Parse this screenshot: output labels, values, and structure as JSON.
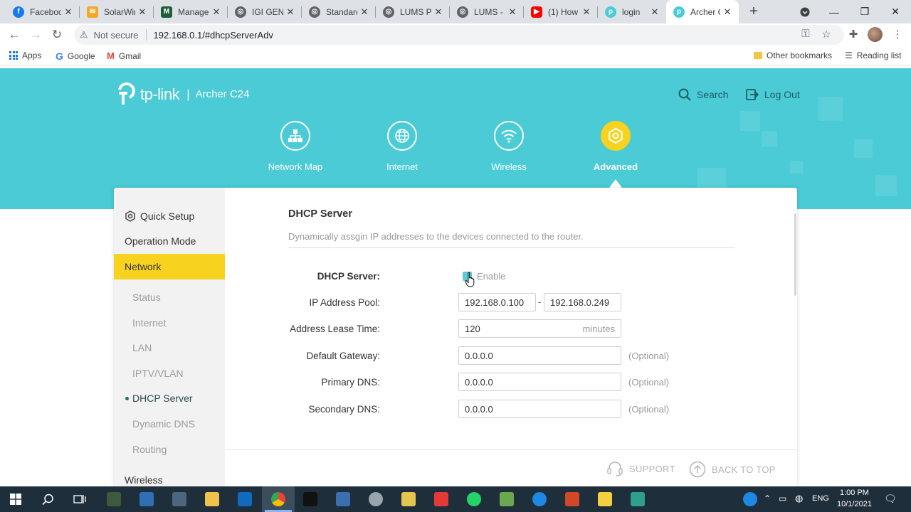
{
  "browser": {
    "tabs": [
      {
        "title": "Facebook",
        "favicon": "facebook-icon",
        "color": "#1877f2",
        "active": false
      },
      {
        "title": "SolarWinds",
        "favicon": "solarwinds-icon",
        "color": "#f5a623",
        "active": false
      },
      {
        "title": "Manage",
        "favicon": "manage-icon",
        "color": "#1b5e3a",
        "active": false
      },
      {
        "title": "IGI GENERAL",
        "favicon": "globe-icon",
        "color": "#5f6368",
        "active": false
      },
      {
        "title": "Standard",
        "favicon": "globe-icon",
        "color": "#5f6368",
        "active": false
      },
      {
        "title": "LUMS PI",
        "favicon": "globe-icon",
        "color": "#5f6368",
        "active": false
      },
      {
        "title": "LUMS - I",
        "favicon": "globe-icon",
        "color": "#5f6368",
        "active": false
      },
      {
        "title": "(1) How",
        "favicon": "youtube-icon",
        "color": "#ff0000",
        "active": false
      },
      {
        "title": "login",
        "favicon": "tplink-icon",
        "color": "#4acbd6",
        "active": false
      },
      {
        "title": "Archer C",
        "favicon": "tplink-icon",
        "color": "#4acbd6",
        "active": true
      }
    ],
    "not_secure": "Not secure",
    "url": "192.168.0.1/#dhcpServerAdv",
    "bookmarks": {
      "apps": "Apps",
      "google": "Google",
      "gmail": "Gmail",
      "other": "Other bookmarks",
      "reading_list": "Reading list"
    }
  },
  "router": {
    "brand": "tp-link",
    "model": "Archer C24",
    "header_links": {
      "search": "Search",
      "logout": "Log Out"
    },
    "nav": [
      {
        "label": "Network Map",
        "icon": "network-map-icon",
        "active": false
      },
      {
        "label": "Internet",
        "icon": "globe-icon",
        "active": false
      },
      {
        "label": "Wireless",
        "icon": "wifi-icon",
        "active": false
      },
      {
        "label": "Advanced",
        "icon": "gear-icon",
        "active": true
      }
    ],
    "sidebar": {
      "quick_setup": "Quick Setup",
      "operation_mode": "Operation Mode",
      "network": "Network",
      "network_sub": [
        "Status",
        "Internet",
        "LAN",
        "IPTV/VLAN",
        "DHCP Server",
        "Dynamic DNS",
        "Routing"
      ],
      "active_sub": "DHCP Server",
      "wireless": "Wireless"
    },
    "section": {
      "title": "DHCP Server",
      "description": "Dynamically assgin IP addresses to the devices connected to the router."
    },
    "form": {
      "dhcp_label": "DHCP Server:",
      "enable_label": "Enable",
      "enabled": true,
      "pool_label": "IP Address Pool:",
      "pool_start": "192.168.0.100",
      "pool_dash": "-",
      "pool_end": "192.168.0.249",
      "lease_label": "Address Lease Time:",
      "lease_value": "120",
      "lease_unit": "minutes",
      "gateway_label": "Default Gateway:",
      "gateway_value": "0.0.0.0",
      "primary_dns_label": "Primary DNS:",
      "primary_dns_value": "0.0.0.0",
      "secondary_dns_label": "Secondary DNS:",
      "secondary_dns_value": "0.0.0.0",
      "optional": "(Optional)"
    },
    "footer": {
      "support": "SUPPORT",
      "back_to_top": "BACK TO TOP"
    },
    "colors": {
      "teal": "#4acbd6",
      "yellow": "#f7d31f"
    }
  },
  "taskbar": {
    "language": "ENG",
    "time": "1:00 PM",
    "date": "10/1/2021"
  }
}
